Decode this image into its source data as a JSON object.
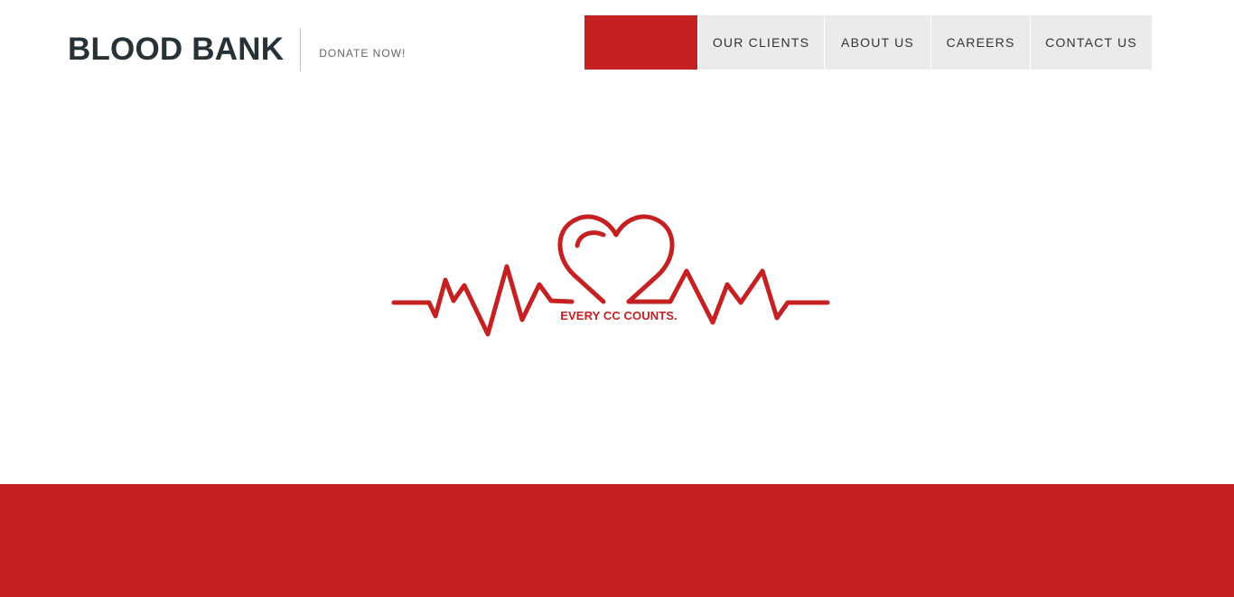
{
  "header": {
    "brand_title": "BLOOD BANK",
    "tagline": "DONATE NOW!"
  },
  "nav": {
    "items": [
      {
        "label": ""
      },
      {
        "label": "OUR CLIENTS"
      },
      {
        "label": "ABOUT US"
      },
      {
        "label": "CAREERS"
      },
      {
        "label": "CONTACT US"
      }
    ]
  },
  "hero": {
    "slogan": "EVERY CC COUNTS.",
    "logo_icon": "heartbeat-heart-icon"
  },
  "colors": {
    "accent": "#c62122",
    "heading": "#263238",
    "nav_bg": "#ebebeb",
    "background": "#ffffff"
  }
}
